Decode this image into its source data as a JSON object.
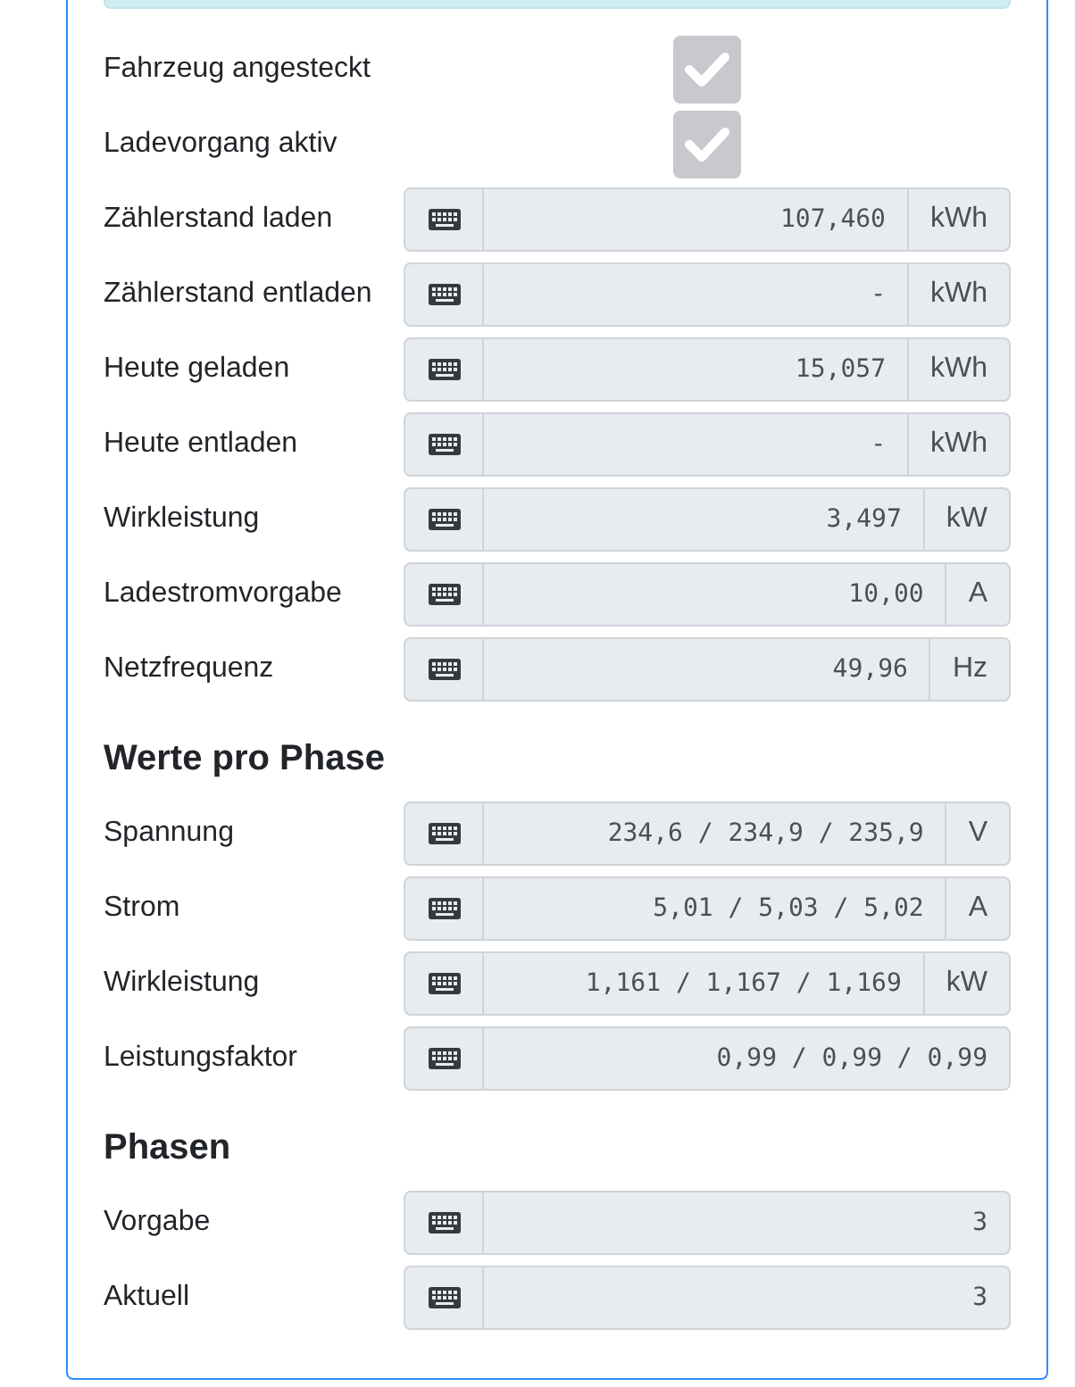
{
  "items": [
    {
      "kind": "checkbox",
      "label": "Fahrzeug angesteckt",
      "checked": true,
      "disabled": true
    },
    {
      "kind": "checkbox",
      "label": "Ladevorgang aktiv",
      "checked": true,
      "disabled": true
    },
    {
      "kind": "field",
      "label": "Zählerstand laden",
      "value": "107,460",
      "unit": "kWh"
    },
    {
      "kind": "field",
      "label": "Zählerstand entladen",
      "value": "-",
      "unit": "kWh"
    },
    {
      "kind": "field",
      "label": "Heute geladen",
      "value": "15,057",
      "unit": "kWh"
    },
    {
      "kind": "field",
      "label": "Heute entladen",
      "value": "-",
      "unit": "kWh"
    },
    {
      "kind": "field",
      "label": "Wirkleistung",
      "value": "3,497",
      "unit": "kW"
    },
    {
      "kind": "field",
      "label": "Ladestromvorgabe",
      "value": "10,00",
      "unit": "A"
    },
    {
      "kind": "field",
      "label": "Netzfrequenz",
      "value": "49,96",
      "unit": "Hz"
    },
    {
      "kind": "heading",
      "label": "Werte pro Phase"
    },
    {
      "kind": "field",
      "label": "Spannung",
      "value": "234,6 / 234,9 / 235,9",
      "unit": "V"
    },
    {
      "kind": "field",
      "label": "Strom",
      "value": "5,01 / 5,03 / 5,02",
      "unit": "A"
    },
    {
      "kind": "field",
      "label": "Wirkleistung",
      "value": "1,161 / 1,167 / 1,169",
      "unit": "kW"
    },
    {
      "kind": "field",
      "label": "Leistungsfaktor",
      "value": "0,99 / 0,99 / 0,99"
    },
    {
      "kind": "heading",
      "label": "Phasen"
    },
    {
      "kind": "field",
      "label": "Vorgabe",
      "value": "3"
    },
    {
      "kind": "field",
      "label": "Aktuell",
      "value": "3"
    }
  ]
}
